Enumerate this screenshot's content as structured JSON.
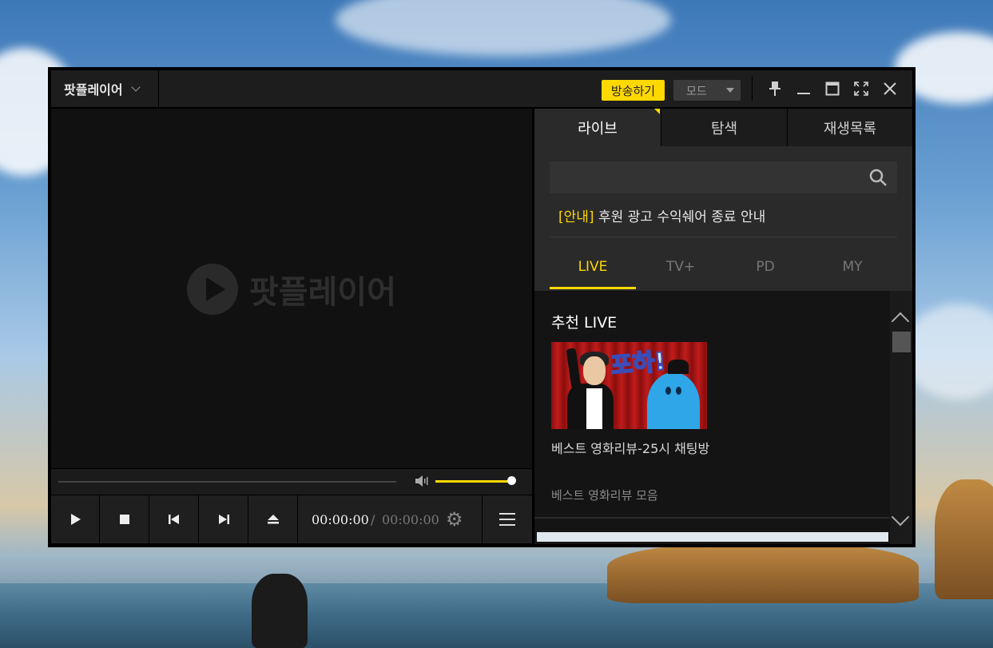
{
  "app": {
    "menu_label": "팟플레이어",
    "broadcast_label": "방송하기",
    "mode_label": "모드",
    "watermark_text": "팟플레이어"
  },
  "window_controls": [
    "pin-icon",
    "minimize-icon",
    "maximize-icon",
    "fullscreen-icon",
    "close-icon"
  ],
  "player": {
    "current_time": "00:00:00",
    "separator": "/",
    "total_time": "00:00:00",
    "volume_level": 0.95,
    "seek_position": 0.0
  },
  "panel": {
    "tabs": [
      {
        "label": "라이브",
        "active": true
      },
      {
        "label": "탐색",
        "active": false
      },
      {
        "label": "재생목록",
        "active": false
      }
    ],
    "search_placeholder": "",
    "notice_tag": "[안내]",
    "notice_text": "후원 광고 수익쉐어 종료 안내",
    "subtabs": [
      {
        "label": "LIVE",
        "active": true
      },
      {
        "label": "TV+",
        "active": false
      },
      {
        "label": "PD",
        "active": false
      },
      {
        "label": "MY",
        "active": false
      }
    ],
    "section_title": "추천 LIVE",
    "item": {
      "thumb_caption": "포하!",
      "title": "베스트 영화리뷰-25시 채팅방",
      "subtitle": "베스트 영화리뷰 모음"
    }
  },
  "colors": {
    "accent": "#ffd800",
    "panel_bg": "#2a2a2a",
    "video_bg": "#111111"
  }
}
